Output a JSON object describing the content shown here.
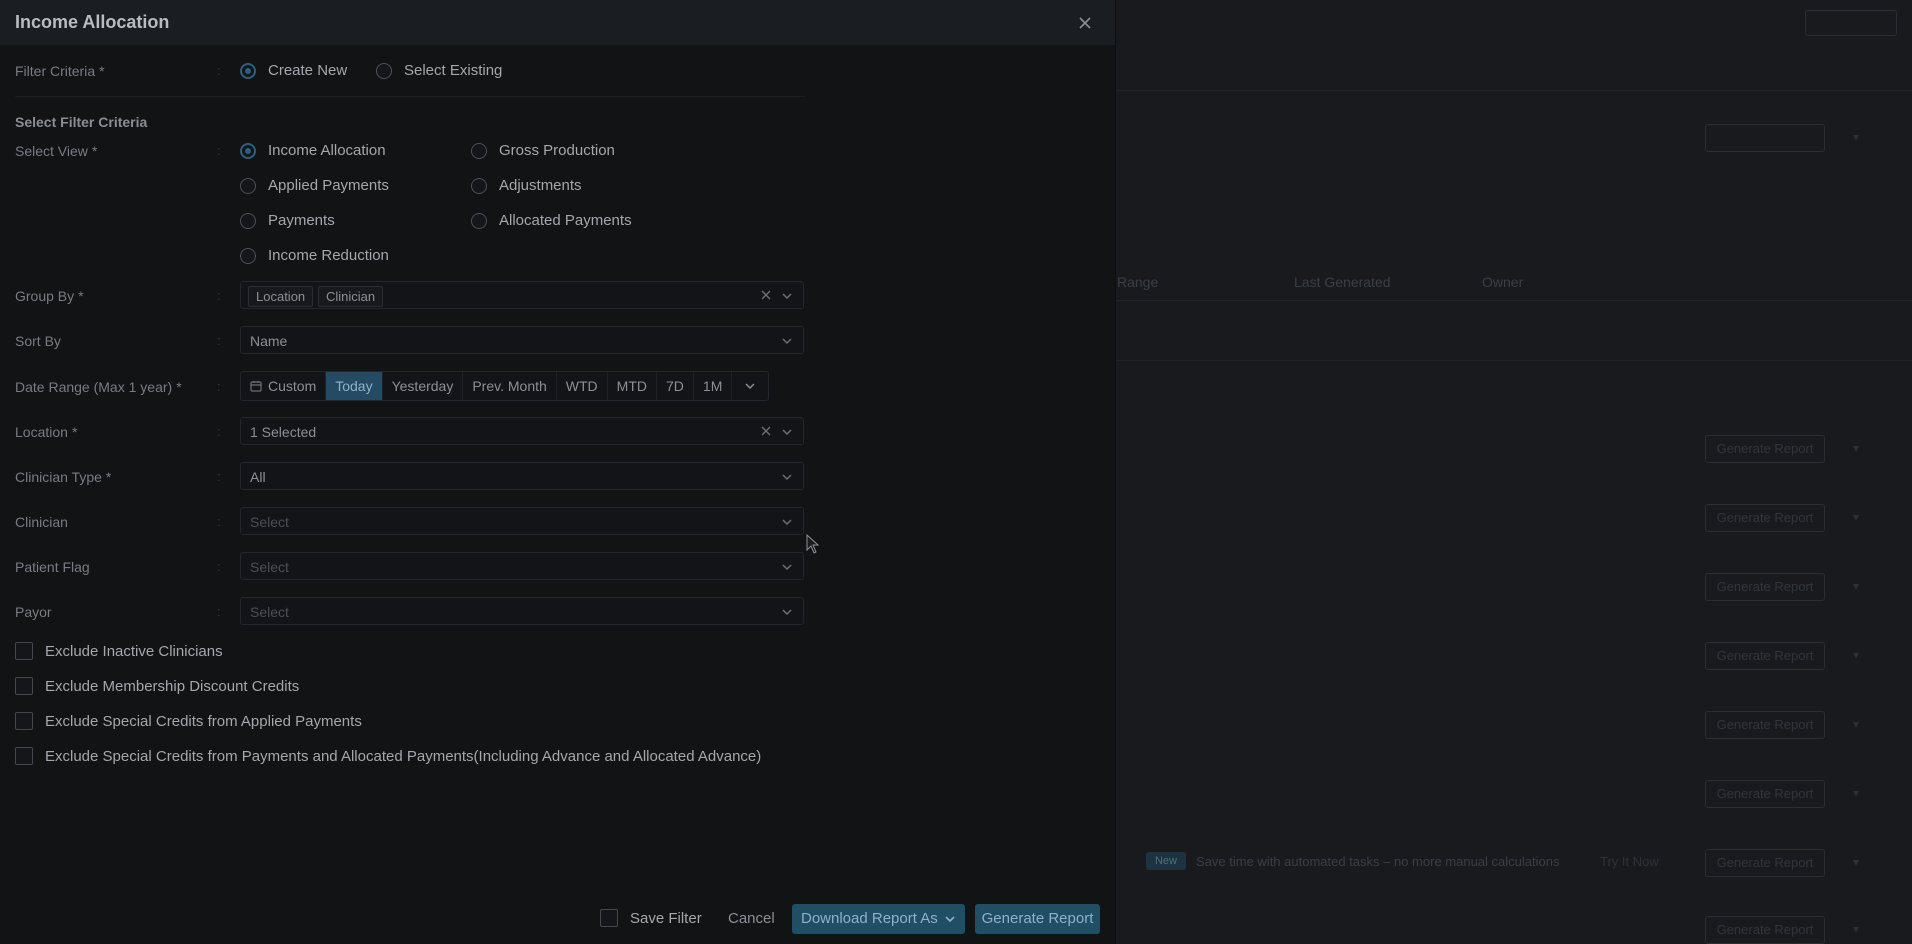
{
  "modal": {
    "title": "Income Allocation",
    "filter_criteria": {
      "label": "Filter Criteria",
      "required": "*",
      "options": [
        "Create New",
        "Select Existing"
      ],
      "selected": "Create New"
    },
    "section_title": "Select Filter Criteria",
    "select_view": {
      "label": "Select View",
      "required": "*",
      "options": [
        "Income Allocation",
        "Gross Production",
        "Applied Payments",
        "Adjustments",
        "Payments",
        "Allocated Payments",
        "Income Reduction"
      ],
      "selected": "Income Allocation"
    },
    "group_by": {
      "label": "Group By",
      "required": "*",
      "chips": [
        "Location",
        "Clinician"
      ]
    },
    "sort_by": {
      "label": "Sort By",
      "value": "Name"
    },
    "date_range": {
      "label": "Date Range (Max 1 year)",
      "required": "*",
      "options": [
        "Custom",
        "Today",
        "Yesterday",
        "Prev. Month",
        "WTD",
        "MTD",
        "7D",
        "1M"
      ],
      "selected": "Today"
    },
    "location": {
      "label": "Location",
      "required": "*",
      "value": "1 Selected"
    },
    "clinician_type": {
      "label": "Clinician Type",
      "required": "*",
      "value": "All"
    },
    "clinician": {
      "label": "Clinician",
      "placeholder": "Select"
    },
    "patient_flag": {
      "label": "Patient Flag",
      "placeholder": "Select"
    },
    "payor": {
      "label": "Payor",
      "placeholder": "Select"
    },
    "checkboxes": [
      "Exclude Inactive Clinicians",
      "Exclude Membership Discount Credits",
      "Exclude Special Credits from Applied Payments",
      "Exclude Special Credits from Payments and Allocated Payments(Including Advance and Allocated Advance)"
    ],
    "footer": {
      "save_filter": "Save Filter",
      "cancel": "Cancel",
      "download": "Download Report As",
      "generate": "Generate Report"
    }
  },
  "background": {
    "col_range": "Range",
    "col_last_generated": "Last Generated",
    "col_owner": "Owner",
    "row_buttons": [
      "Generate Report",
      "Generate Report",
      "Generate Report",
      "Generate Report",
      "Generate Report",
      "Generate Report",
      "Generate Report",
      "Generate Report"
    ],
    "banner_badge": "New",
    "banner_text": "Save time with automated tasks – no more manual calculations",
    "banner_link": "Try It Now"
  },
  "colors": {
    "accent": "#254b64",
    "modal_bg": "#111315",
    "header_bg": "#1a1d21"
  }
}
